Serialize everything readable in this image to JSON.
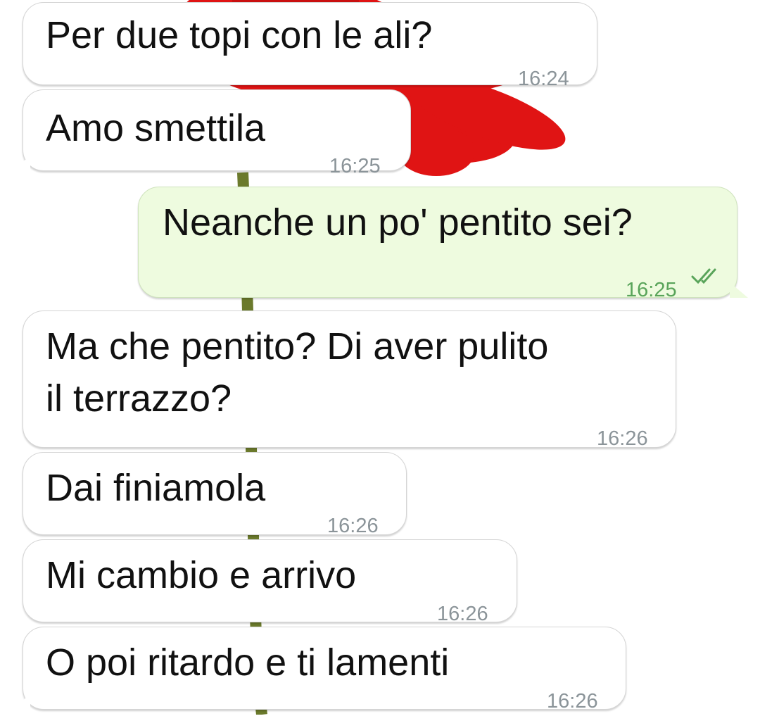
{
  "colors": {
    "incoming_bubble": "#ffffff",
    "outgoing_bubble": "#eefbdf",
    "timestamp": "#8b9499",
    "outgoing_timestamp": "#59a45a",
    "read_ticks": "#59a45a",
    "wallpaper_flower": "#e01414",
    "wallpaper_stem": "#6b7a2c"
  },
  "wallpaper": {
    "description_icon": "red-gerbera-flower-icon"
  },
  "messages": [
    {
      "direction": "incoming",
      "lines": [
        "Per due topi con le ali?"
      ],
      "time": "16:24"
    },
    {
      "direction": "incoming",
      "lines": [
        "Amo smettila"
      ],
      "time": "16:25"
    },
    {
      "direction": "outgoing",
      "lines": [
        "Neanche un po' pentito sei?"
      ],
      "time": "16:25",
      "status_icon": "double-check-read-icon"
    },
    {
      "direction": "incoming",
      "lines": [
        "Ma che pentito? Di aver pulito",
        "il terrazzo?"
      ],
      "time": "16:26"
    },
    {
      "direction": "incoming",
      "lines": [
        "Dai finiamola"
      ],
      "time": "16:26"
    },
    {
      "direction": "incoming",
      "lines": [
        "Mi cambio e arrivo"
      ],
      "time": "16:26"
    },
    {
      "direction": "incoming",
      "lines": [
        "O poi ritardo e ti lamenti"
      ],
      "time": "16:26"
    }
  ]
}
